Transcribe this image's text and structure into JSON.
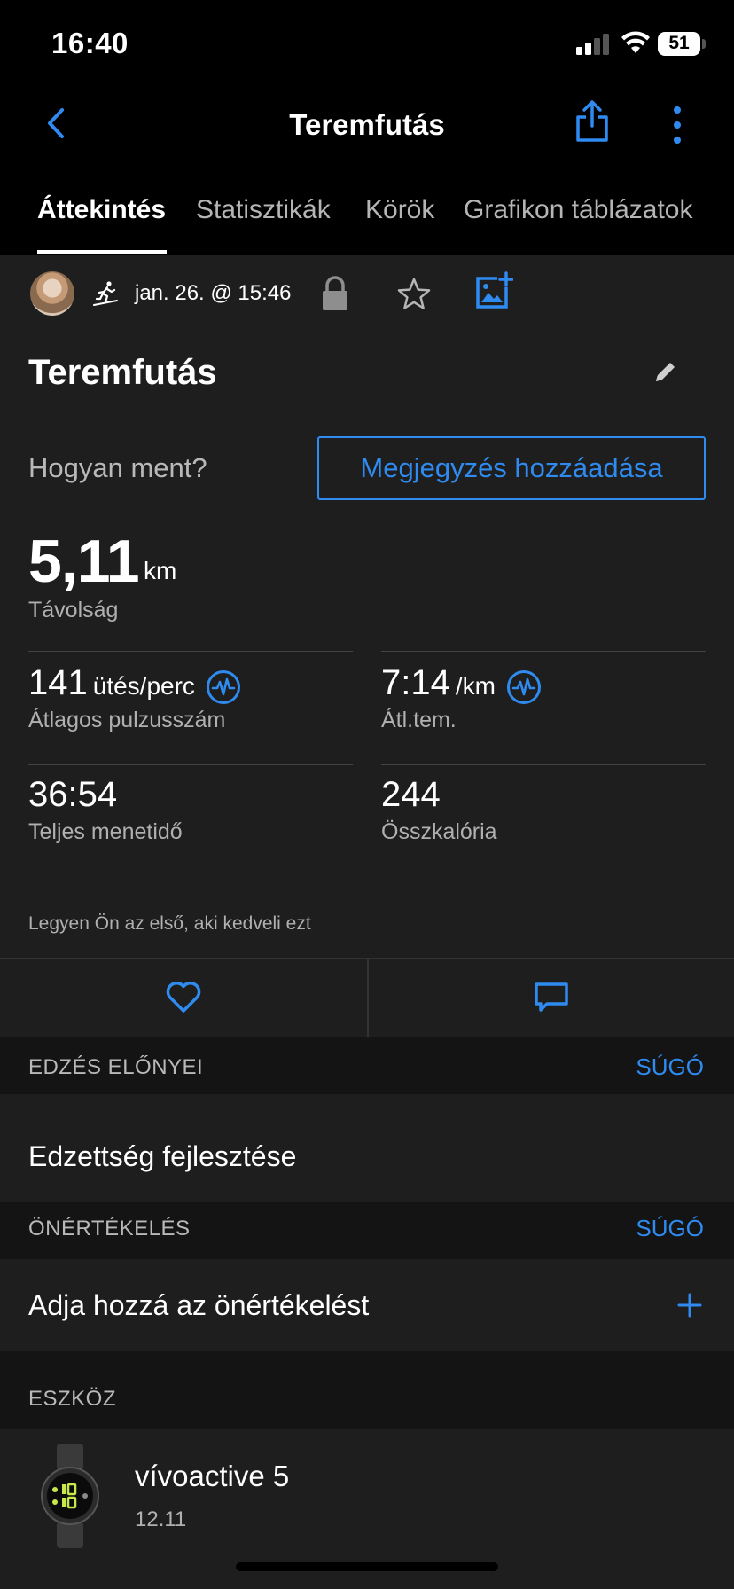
{
  "status_bar": {
    "time": "16:40",
    "battery": "51"
  },
  "nav": {
    "title": "Teremfutás"
  },
  "tabs": [
    {
      "label": "Áttekintés",
      "active": true
    },
    {
      "label": "Statisztikák",
      "active": false
    },
    {
      "label": "Körök",
      "active": false
    },
    {
      "label": "Grafikon táblázatok",
      "active": false
    }
  ],
  "activity": {
    "date": "jan. 26. @ 15:46",
    "title": "Teremfutás",
    "how_prompt": "Hogyan ment?",
    "note_button": "Megjegyzés hozzáadása"
  },
  "distance": {
    "value": "5,11",
    "unit": "km",
    "label": "Távolság"
  },
  "stats": {
    "heart_rate": {
      "value": "141",
      "unit": "ütés/perc",
      "label": "Átlagos pulzusszám"
    },
    "pace": {
      "value": "7:14",
      "unit": "/km",
      "label": "Átl.tem."
    },
    "time": {
      "value": "36:54",
      "label": "Teljes menetidő"
    },
    "calories": {
      "value": "244",
      "label": "Összkalória"
    }
  },
  "social": {
    "like_text": "Legyen Ön az első, aki kedveli ezt"
  },
  "sections": {
    "benefits": {
      "title": "EDZÉS ELŐNYEI",
      "link": "SÚGÓ",
      "row": "Edzettség fejlesztése"
    },
    "self_eval": {
      "title": "ÖNÉRTÉKELÉS",
      "link": "SÚGÓ",
      "row": "Adja hozzá az önértékelést"
    },
    "device": {
      "title": "ESZKÖZ",
      "name": "vívoactive 5",
      "version": "12.11"
    }
  },
  "colors": {
    "accent": "#2f8bf0",
    "background": "#1e1e1e",
    "header_bg": "#000000"
  }
}
